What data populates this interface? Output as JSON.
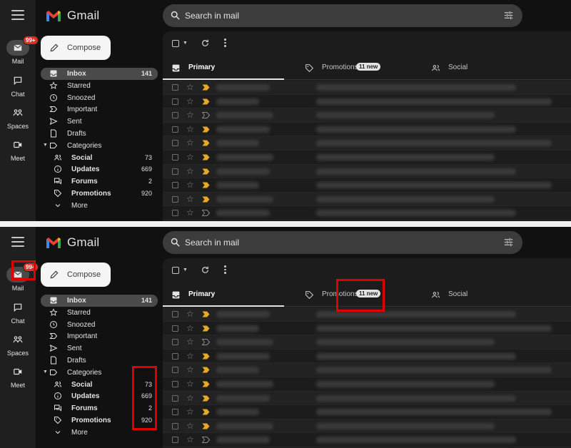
{
  "rail": {
    "items": [
      {
        "label": "Mail",
        "badge": "99+"
      },
      {
        "label": "Chat"
      },
      {
        "label": "Spaces"
      },
      {
        "label": "Meet"
      }
    ]
  },
  "header": {
    "brand": "Gmail",
    "search_placeholder": "Search in mail"
  },
  "compose": {
    "label": "Compose"
  },
  "nav": {
    "items": [
      {
        "label": "Inbox",
        "count": "141",
        "icon": "inbox-icon"
      },
      {
        "label": "Starred",
        "icon": "star-icon"
      },
      {
        "label": "Snoozed",
        "icon": "clock-icon"
      },
      {
        "label": "Important",
        "icon": "important-icon"
      },
      {
        "label": "Sent",
        "icon": "send-icon"
      },
      {
        "label": "Drafts",
        "icon": "draft-icon"
      },
      {
        "label": "Categories",
        "icon": "label-icon"
      },
      {
        "label": "Social",
        "count": "73",
        "icon": "people-icon"
      },
      {
        "label": "Updates",
        "count": "669",
        "icon": "info-icon"
      },
      {
        "label": "Forums",
        "count": "2",
        "icon": "forum-icon"
      },
      {
        "label": "Promotions",
        "count": "920",
        "icon": "tag-icon"
      },
      {
        "label": "More",
        "icon": "chevron-down-icon"
      }
    ]
  },
  "tabs": [
    {
      "label": "Primary"
    },
    {
      "label": "Promotions",
      "badge": "11 new"
    },
    {
      "label": "Social"
    }
  ],
  "colors": {
    "background": "#111111",
    "highlight": "#e00000",
    "badge": "#d93025"
  }
}
